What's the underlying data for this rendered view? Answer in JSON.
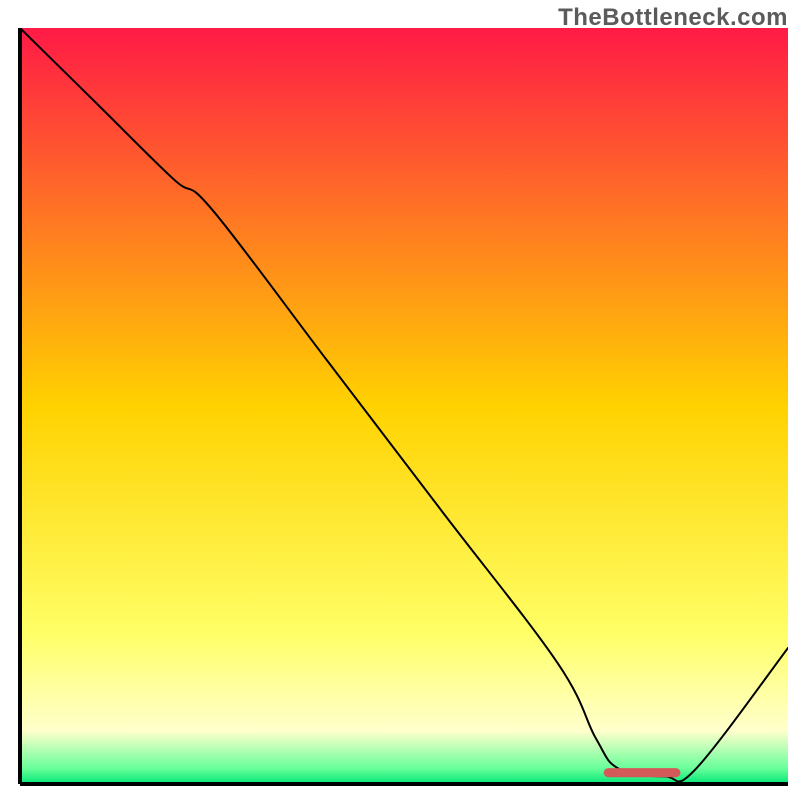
{
  "watermark": "TheBottleneck.com",
  "chart_data": {
    "type": "line",
    "title": "",
    "xlabel": "",
    "ylabel": "",
    "xlim": [
      0,
      100
    ],
    "ylim": [
      0,
      100
    ],
    "grid": false,
    "background": {
      "type": "vertical-gradient",
      "stops": [
        {
          "offset": 0.0,
          "color": "#ff1a46"
        },
        {
          "offset": 0.5,
          "color": "#ffd200"
        },
        {
          "offset": 0.8,
          "color": "#ffff66"
        },
        {
          "offset": 0.93,
          "color": "#ffffcc"
        },
        {
          "offset": 0.98,
          "color": "#66ff99"
        },
        {
          "offset": 1.0,
          "color": "#00e676"
        }
      ]
    },
    "series": [
      {
        "name": "curve",
        "color": "#000000",
        "stroke_width": 2,
        "x": [
          0,
          10,
          20,
          25,
          40,
          55,
          70,
          75,
          78,
          84,
          88,
          100
        ],
        "y": [
          100,
          90,
          80,
          76,
          56,
          36,
          16,
          6,
          2,
          1,
          2,
          18
        ]
      }
    ],
    "markers": [
      {
        "name": "target-segment",
        "type": "rounded-segment",
        "color": "#d45a5a",
        "x0": 76,
        "x1": 86,
        "y": 1.5,
        "thickness_pct": 1.2
      }
    ],
    "axes": {
      "left": {
        "visible": true,
        "color": "#000000",
        "width": 2
      },
      "bottom": {
        "visible": true,
        "color": "#000000",
        "width": 2
      },
      "top": {
        "visible": false
      },
      "right": {
        "visible": false
      }
    }
  }
}
